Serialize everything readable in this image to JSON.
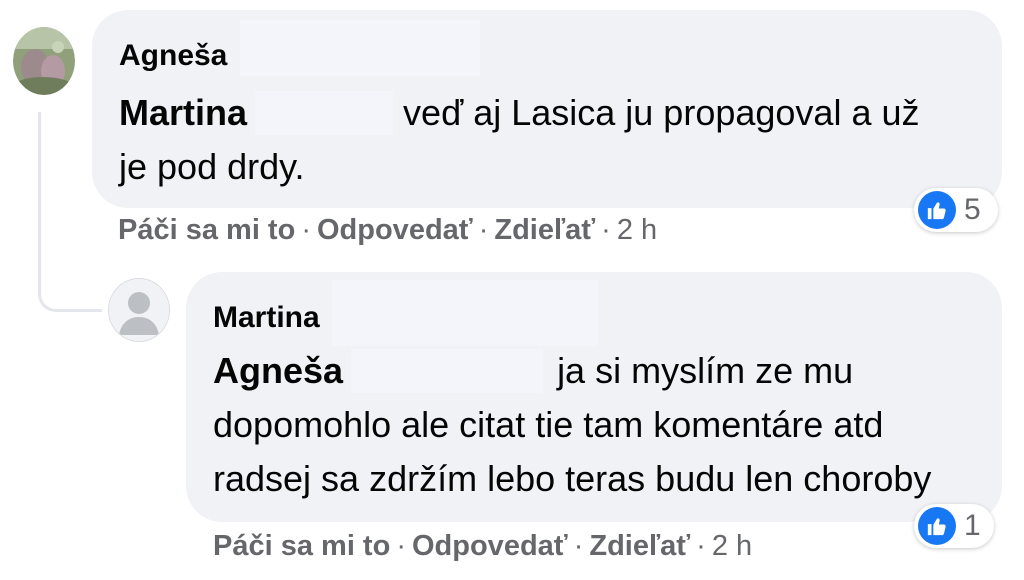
{
  "comments": [
    {
      "author": "Agneša",
      "mention": "Martina",
      "text_line1": "veď aj Lasica ju propagoval a už",
      "text_line2": "je pod drdy.",
      "actions": {
        "like": "Páči sa mi to",
        "reply": "Odpovedať",
        "share": "Zdieľať",
        "time": "2 h"
      },
      "reactions": {
        "icon": "like-icon",
        "count": "5"
      }
    },
    {
      "author": "Martina",
      "mention": "Agneša",
      "text_line1": "ja si myslím ze mu",
      "text_line2": "dopomohlo ale citat tie tam komentáre atd",
      "text_line3": "radsej sa zdržím lebo teras budu len choroby",
      "actions": {
        "like": "Páči sa mi to",
        "reply": "Odpovedať",
        "share": "Zdieľať",
        "time": "2 h"
      },
      "reactions": {
        "icon": "like-icon",
        "count": "1"
      }
    }
  ],
  "separator": "·",
  "colors": {
    "bubble": "#f0f2f5",
    "muted": "#65676b",
    "like_blue": "#1877f2",
    "thread_line": "#e4e6eb"
  }
}
